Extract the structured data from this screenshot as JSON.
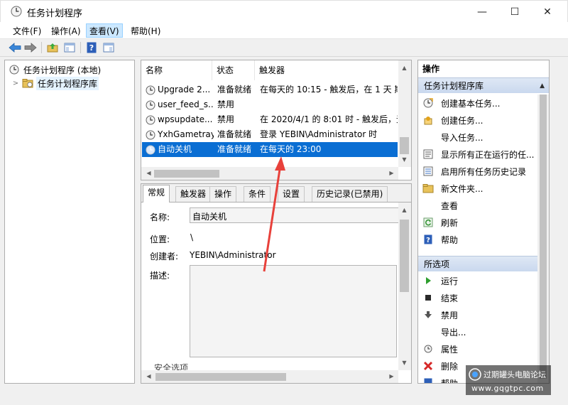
{
  "window": {
    "title": "任务计划程序",
    "minimize_glyph": "—",
    "maximize_glyph": "☐",
    "close_glyph": "✕"
  },
  "menu": [
    {
      "label": "文件(F)"
    },
    {
      "label": "操作(A)"
    },
    {
      "label": "查看(V)",
      "active": true
    },
    {
      "label": "帮助(H)"
    }
  ],
  "toolbar": {
    "buttons": [
      "back-arrow-icon",
      "forward-arrow-icon",
      "up-folder-icon",
      "show-hide-tree-icon",
      "help-icon",
      "action-pane-icon"
    ]
  },
  "tree": {
    "root_label": "任务计划程序 (本地)",
    "library_label": "任务计划程序库"
  },
  "task_list": {
    "columns": {
      "name": "名称",
      "status": "状态",
      "trigger": "触发器"
    },
    "rows": [
      {
        "name": "Upgrade 2...",
        "status": "准备就绪",
        "trigger": "在每天的 10:15 - 触发后，在 1 天 期"
      },
      {
        "name": "user_feed_s...",
        "status": "禁用",
        "trigger": ""
      },
      {
        "name": "wpsupdate...",
        "status": "禁用",
        "trigger": "在 2020/4/1 的 8:01 时 - 触发后，无"
      },
      {
        "name": "YxhGametray",
        "status": "准备就绪",
        "trigger": "登录 YEBIN\\Administrator 时"
      },
      {
        "name": "自动关机",
        "status": "准备就绪",
        "trigger": "在每天的 23:00",
        "selected": true
      }
    ]
  },
  "detail": {
    "tabs": [
      "常规",
      "触发器",
      "操作",
      "条件",
      "设置",
      "历史记录(已禁用)"
    ],
    "fields": {
      "name_label": "名称:",
      "name_value": "自动关机",
      "location_label": "位置:",
      "location_value": "\\",
      "author_label": "创建者:",
      "author_value": "YEBIN\\Administrator",
      "description_label": "描述:",
      "security_label": "安全选项"
    }
  },
  "actions": {
    "header": "操作",
    "group1": {
      "title": "任务计划程序库",
      "items": [
        {
          "label": "创建基本任务...",
          "icon": "create-basic-task-icon"
        },
        {
          "label": "创建任务...",
          "icon": "create-task-icon"
        },
        {
          "label": "导入任务...",
          "icon": ""
        },
        {
          "label": "显示所有正在运行的任...",
          "icon": "running-tasks-icon"
        },
        {
          "label": "启用所有任务历史记录",
          "icon": "history-icon"
        },
        {
          "label": "新文件夹...",
          "icon": "new-folder-icon"
        },
        {
          "label": "查看",
          "icon": "",
          "submenu": true
        },
        {
          "label": "刷新",
          "icon": "refresh-icon"
        },
        {
          "label": "帮助",
          "icon": "help-icon"
        }
      ]
    },
    "group2": {
      "title": "所选项",
      "items": [
        {
          "label": "运行",
          "icon": "run-icon"
        },
        {
          "label": "结束",
          "icon": "stop-icon"
        },
        {
          "label": "禁用",
          "icon": "disable-icon"
        },
        {
          "label": "导出...",
          "icon": ""
        },
        {
          "label": "属性",
          "icon": "properties-icon"
        },
        {
          "label": "删除",
          "icon": "delete-icon"
        },
        {
          "label": "帮助",
          "icon": "help-icon"
        }
      ]
    }
  },
  "watermark": {
    "line1": "过期罐头电脑论坛",
    "line2": "www.gqgtpc.com"
  },
  "colors": {
    "selection": "#0a6ed3",
    "annotation_arrow": "#e8413b",
    "group_header": "#c9d8ee"
  }
}
